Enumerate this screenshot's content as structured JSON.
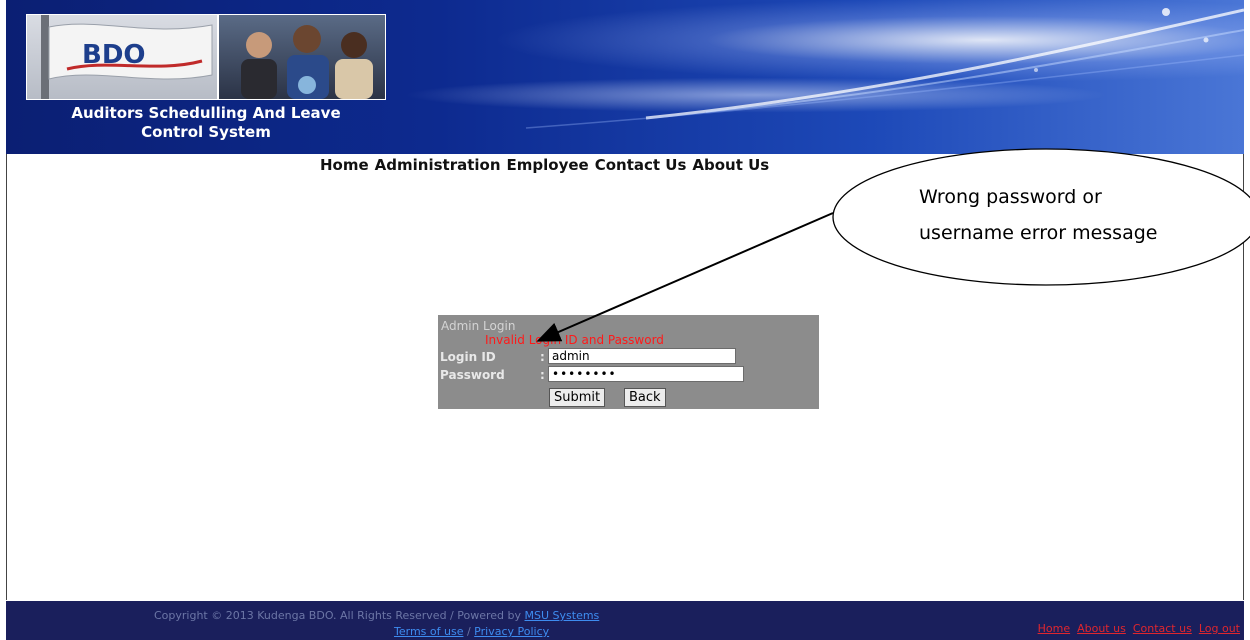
{
  "header": {
    "site_title_line1": "Auditors Schedulling And Leave",
    "site_title_line2": "Control System",
    "logo_text": "BDO"
  },
  "nav": {
    "items": [
      "Home",
      "Administration",
      "Employee",
      "Contact Us",
      "About Us"
    ]
  },
  "login": {
    "title": "Admin Login",
    "error": "Invalid Login ID and Password",
    "login_id_label": "Login ID",
    "password_label": "Password",
    "colon": ":",
    "login_id_value": "admin",
    "password_value": "••••••••",
    "submit_label": "Submit",
    "back_label": "Back"
  },
  "callout": {
    "line1": "Wrong password or",
    "line2": "username error message"
  },
  "footer": {
    "copyright": "Copyright © 2013 Kudenga BDO. All Rights Reserved / Powered by ",
    "powered_link": "MSU Systems",
    "terms_link": "Terms of use",
    "separator": " / ",
    "privacy_link": "Privacy Policy",
    "links": [
      "Home",
      "About us",
      "Contact us",
      "Log out"
    ]
  },
  "colors": {
    "header_blue": "#0d2a8f",
    "footer_navy": "#1a1f5c",
    "login_bg": "#8c8c8c",
    "error_red": "#ff1a1a",
    "footer_link_red": "#e0262e"
  }
}
